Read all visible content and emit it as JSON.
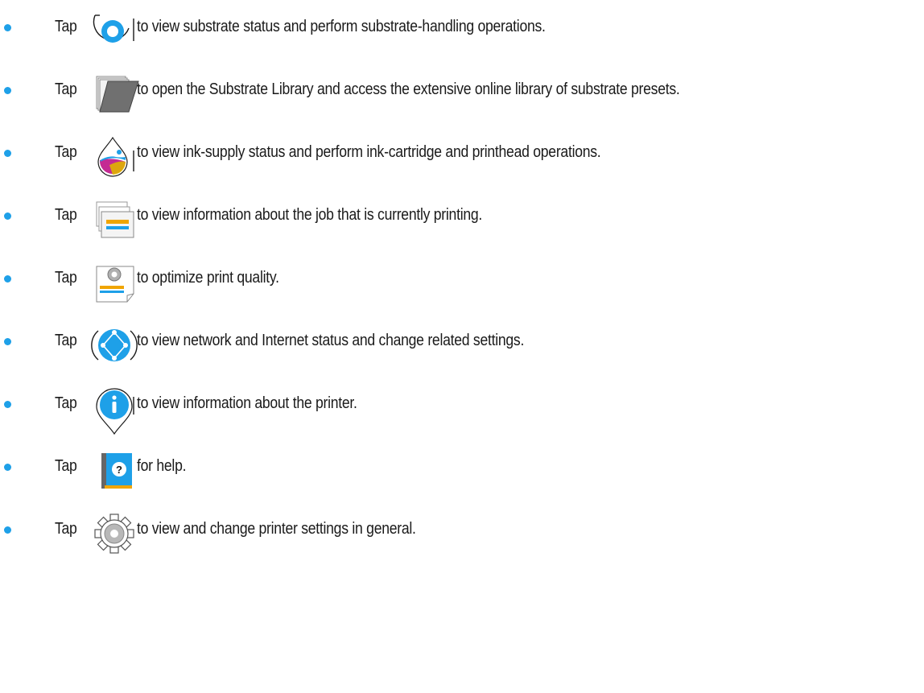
{
  "accent_color": "#1ea0e8",
  "tap_label": "Tap",
  "items": [
    {
      "icon": "substrate-roll-icon",
      "text": "to view substrate status and perform substrate-handling operations."
    },
    {
      "icon": "substrate-library-folder-icon",
      "text": "to open the Substrate Library and access the extensive online library of substrate presets."
    },
    {
      "icon": "ink-drop-icon",
      "text": "to view ink-supply status and perform ink-cartridge and printhead operations."
    },
    {
      "icon": "job-queue-icon",
      "text": "to view information about the job that is currently printing."
    },
    {
      "icon": "print-quality-icon",
      "text": "to optimize print quality."
    },
    {
      "icon": "network-globe-icon",
      "text": "to view network and Internet status and change related settings."
    },
    {
      "icon": "info-icon",
      "text": "to view information about the printer."
    },
    {
      "icon": "help-book-icon",
      "text": "for help."
    },
    {
      "icon": "settings-gear-icon",
      "text": "to view and change printer settings in general."
    }
  ]
}
